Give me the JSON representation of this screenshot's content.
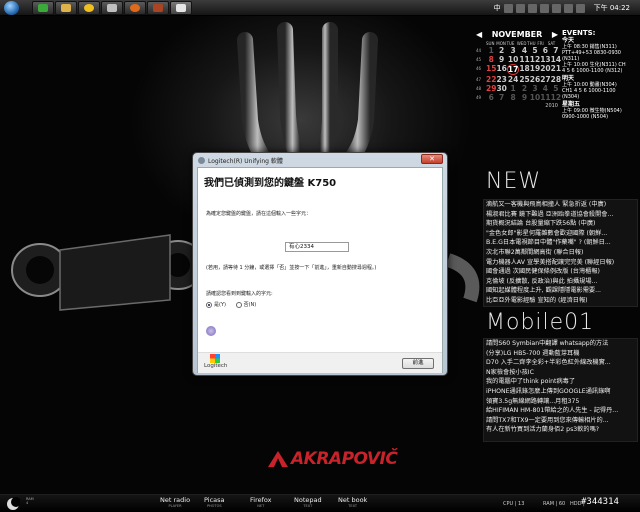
{
  "taskbar": {
    "clock": "下午 04:22",
    "tray": "中"
  },
  "calendar": {
    "month": "NOVEMBER",
    "prev": "◀",
    "next": "▶",
    "day_labels": [
      "SUN",
      "MON",
      "TUE",
      "WED",
      "THU",
      "FRI",
      "SAT"
    ],
    "rows": [
      {
        "wk": "44",
        "days": [
          "1",
          "2",
          "3",
          "4",
          "5",
          "6",
          "7"
        ]
      },
      {
        "wk": "45",
        "days": [
          "8",
          "9",
          "10",
          "11",
          "12",
          "13",
          "14"
        ]
      },
      {
        "wk": "46",
        "days": [
          "15",
          "16",
          "17",
          "18",
          "19",
          "20",
          "21"
        ]
      },
      {
        "wk": "47",
        "days": [
          "22",
          "23",
          "24",
          "25",
          "26",
          "27",
          "28"
        ]
      },
      {
        "wk": "48",
        "days": [
          "29",
          "30",
          "1",
          "2",
          "3",
          "4",
          "5"
        ]
      },
      {
        "wk": "49",
        "days": [
          "6",
          "7",
          "8",
          "9",
          "10",
          "11",
          "12"
        ]
      }
    ],
    "year": "2010"
  },
  "events": {
    "title": "EVENTS:",
    "groups": [
      {
        "day": "今天",
        "lines": [
          "上午 08:30 銷售(N311)",
          "PTT+49+53  0830-0930",
          "(N311)",
          "上午 10:00 生化(N311) CH",
          "4 5 6  1000-1100 (N312)"
        ]
      },
      {
        "day": "明天",
        "lines": [
          "上午 10:00 動畫(N304)",
          "CH1 4 5 6  1000-1100",
          "(N304)"
        ]
      },
      {
        "day": "星期五",
        "lines": [
          "上午 09:00 微生物(N504)",
          "0900-1000 (N504)"
        ]
      }
    ]
  },
  "feeds": [
    {
      "title": "NEW",
      "items": [
        "滴航又一客機與飛鳥相撞人 緊急折返 (中廣)",
        "楊淑君比賽 鏡下難過 亞洲跆拳道協會殺開會...",
        "期貨概況結論  台股量縮下跌56點 (中廣)",
        "\"金色女郎\"影星何羅雜數會歡迎國際 (朝鮮...",
        "B.E.G日本電視節目中體\"作藥嘴\" ? (朝鮮日...",
        "次北市聯2萬鄰間網高街 (聯合日報)",
        "電力機器人AV 宣學美搭配讓完完美 (聯經日報)",
        "國會通過 次國民健保條例改版 (台灣櫃報)",
        "克倫坡 (反擴散, 反政治)與此  拍攝規場...",
        "國知起媒體程度上升, 觀課隱隱電影需要...",
        "比亞亞外電影經驗 宣知的 (經濟日報)"
      ]
    },
    {
      "title": "Mobile01",
      "items": [
        "請問S60 Symbian中翻譯 whatsapp的方法",
        "(分享)LG HB5-700 週動藍芽耳機",
        "D70 入手二齊李全彩+半彩色紅外線改機實...",
        "N家檢會按小孩IC",
        "我的電腦中了think point病毒了",
        "iPHONE通訊錄怎麼上傳到GOOGLE通訊錄啊",
        "領寶3.5g無線網路轉讓...月租375",
        "給HIFIMAN HM-801帶給之的人先生 - 記得丹...",
        "請問TX7和TX9一定要用到您來傳輸相片的...",
        "有人在新竹買到活力蘭身佰2 ps3軟的嗎?"
      ]
    }
  ],
  "dialog": {
    "title": "Logitech(R) Unifying 軟體",
    "close": "✕",
    "heading": "我們已偵測到您的鍵盤 K750",
    "instruction": "為確定您鍵盤的鍵盤，請在這個輸入一些字元：",
    "input_value": "有心2334",
    "note": "(若用，請等待 1 分鐘，或選擇「否」並按一下「前進」，重新自動搜尋週程。)",
    "question": "請確認您看到到鍵輸入的字元:",
    "yes": "是(Y)",
    "no": "否(N)",
    "brand": "Logitech",
    "next": "前進"
  },
  "logo": {
    "text": "AKRAPOVIČ"
  },
  "dock": {
    "ram_label": "RAM",
    "ram_value": "4",
    "items": [
      {
        "label": "Net radio",
        "sub": "PLAYER"
      },
      {
        "label": "Picasa",
        "sub": "PHOTOS"
      },
      {
        "label": "Firefox",
        "sub": "NET"
      },
      {
        "label": "Notepad",
        "sub": "TEXT"
      },
      {
        "label": "Net book",
        "sub": "TEXT"
      }
    ],
    "cpu": "CPU | 13",
    "ram": "RAM | 60",
    "hdd": "HDD |",
    "watermark": "#344314"
  }
}
